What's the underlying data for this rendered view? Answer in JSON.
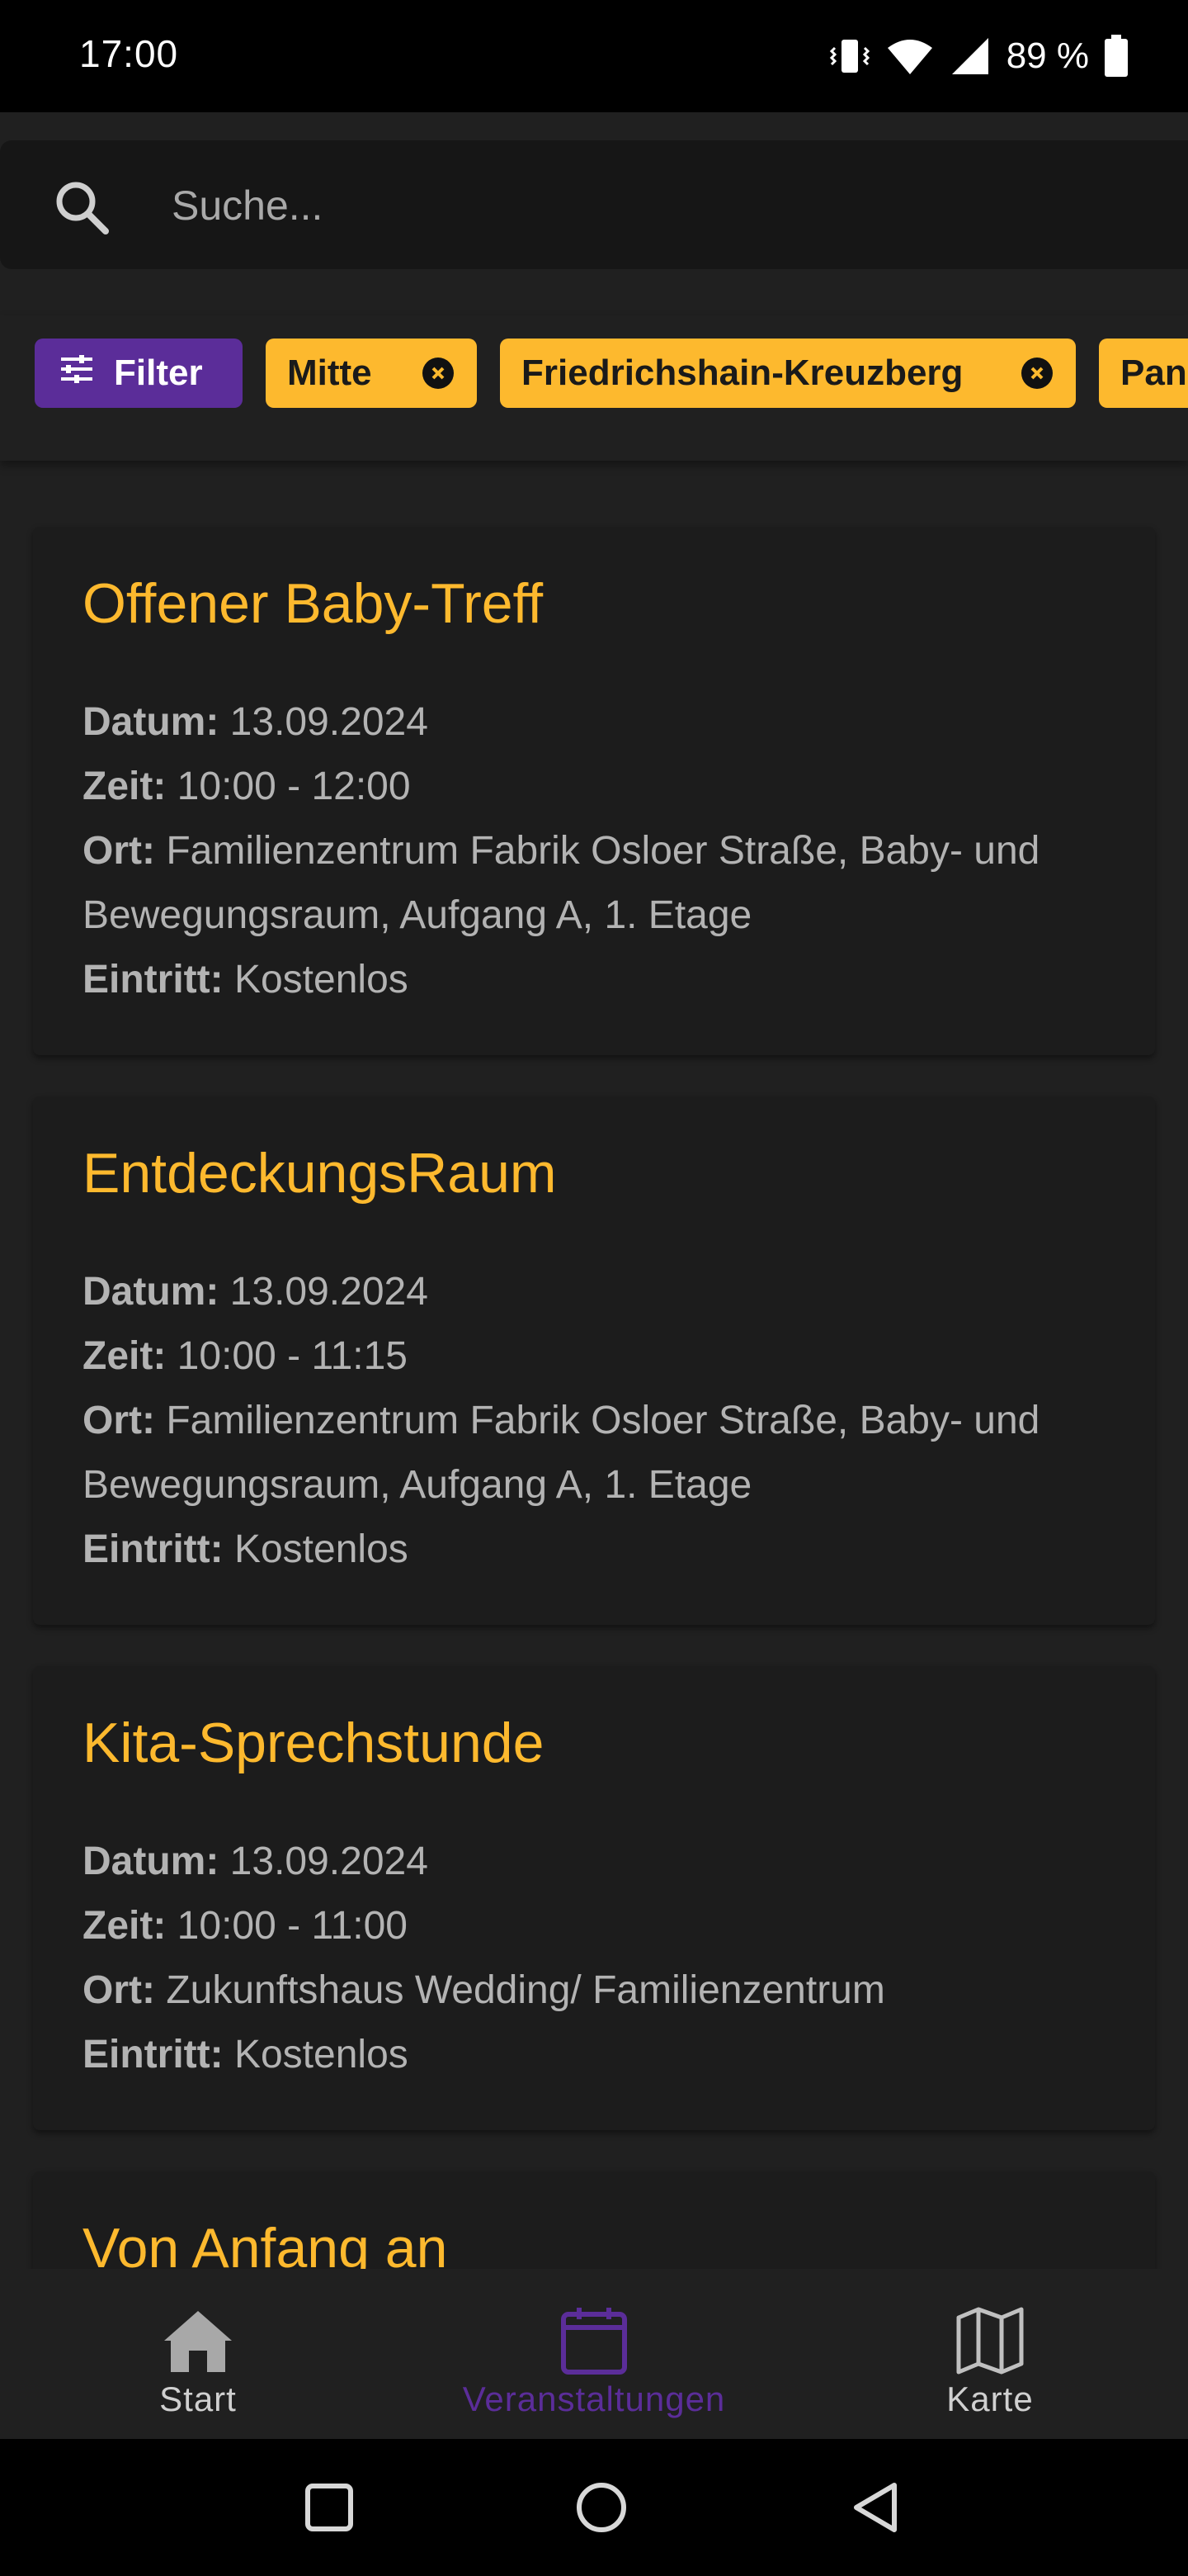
{
  "status": {
    "time": "17:00",
    "battery": "89 %"
  },
  "search": {
    "placeholder": "Suche...",
    "value": ""
  },
  "filters": {
    "filter_label": "Filter",
    "chips": [
      "Mitte",
      "Friedrichshain-Kreuzberg",
      "Pan"
    ]
  },
  "labels": {
    "date": "Datum:",
    "time": "Zeit:",
    "place": "Ort:",
    "entry": "Eintritt:"
  },
  "events": [
    {
      "title": "Offener Baby-Treff",
      "date": "13.09.2024",
      "time": "10:00 - 12:00",
      "place_line1": "Familienzentrum Fabrik Osloer Straße, Baby- und",
      "place_line2": "Bewegungsraum, Aufgang A, 1. Etage",
      "entry": "Kostenlos"
    },
    {
      "title": "EntdeckungsRaum",
      "date": "13.09.2024",
      "time": "10:00 - 11:15",
      "place_line1": "Familienzentrum Fabrik Osloer Straße, Baby- und",
      "place_line2": "Bewegungsraum, Aufgang A, 1. Etage",
      "entry": "Kostenlos"
    },
    {
      "title": "Kita-Sprechstunde",
      "date": "13.09.2024",
      "time": "10:00 - 11:00",
      "place_line1": "Zukunftshaus Wedding/ Familienzentrum",
      "entry": "Kostenlos"
    },
    {
      "title": "Von Anfang an"
    }
  ],
  "nav": {
    "items": [
      {
        "label": "Start",
        "icon": "home-icon",
        "active": false
      },
      {
        "label": "Veranstaltungen",
        "icon": "calendar-icon",
        "active": true
      },
      {
        "label": "Karte",
        "icon": "map-icon",
        "active": false
      }
    ]
  },
  "colors": {
    "accent": "#fdb92e",
    "primary": "#5b2d99",
    "background": "#202020",
    "card": "#1c1c1c",
    "text_muted": "#b3b3b3"
  }
}
